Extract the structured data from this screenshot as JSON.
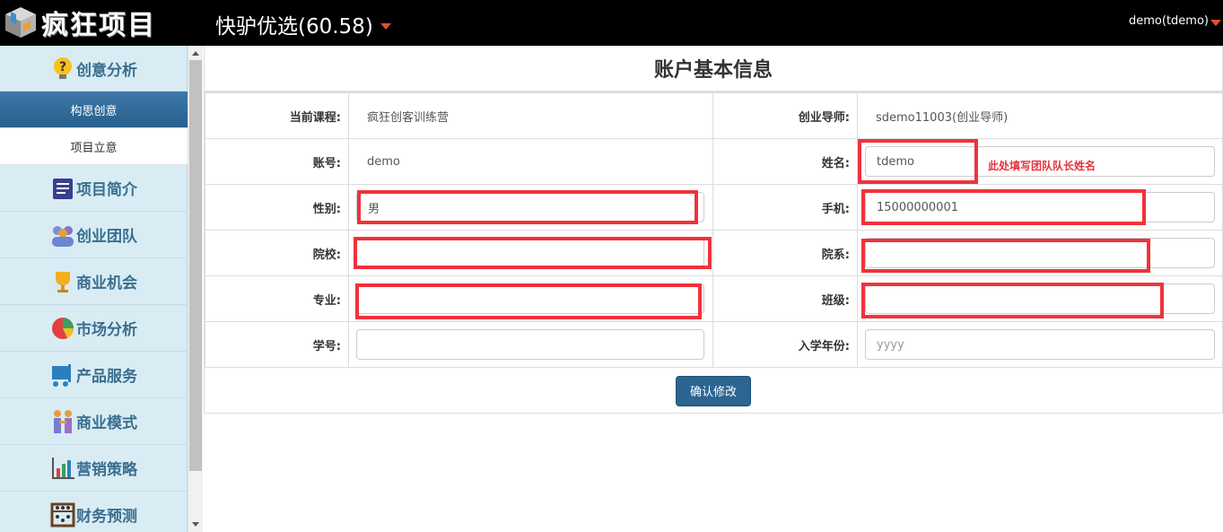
{
  "topbar": {
    "logo_text": "疯狂项目",
    "project_title": "快驴优选(60.58)",
    "user": "demo(tdemo)"
  },
  "sidebar": {
    "categories": [
      {
        "label": "创意分析",
        "icon": "lightbulb-question-icon"
      },
      {
        "label": "项目简介",
        "icon": "document-icon"
      },
      {
        "label": "创业团队",
        "icon": "team-icon"
      },
      {
        "label": "商业机会",
        "icon": "trophy-icon"
      },
      {
        "label": "市场分析",
        "icon": "pie-chart-icon"
      },
      {
        "label": "产品服务",
        "icon": "cart-icon"
      },
      {
        "label": "商业模式",
        "icon": "handshake-icon"
      },
      {
        "label": "营销策略",
        "icon": "bar-chart-icon"
      },
      {
        "label": "财务预测",
        "icon": "abacus-icon"
      }
    ],
    "subitems": [
      {
        "label": "构思创意",
        "active": true
      },
      {
        "label": "项目立意",
        "active": false
      }
    ]
  },
  "panel": {
    "title": "账户基本信息",
    "hint": "此处填写团队队长姓名",
    "submit_label": "确认修改",
    "fields": {
      "course": {
        "label": "当前课程:",
        "value": "疯狂创客训练营"
      },
      "mentor": {
        "label": "创业导师:",
        "value": "sdemo11003(创业导师)"
      },
      "account": {
        "label": "账号:",
        "value": "demo"
      },
      "name": {
        "label": "姓名:",
        "value": "tdemo"
      },
      "gender": {
        "label": "性别:",
        "value": "男"
      },
      "phone": {
        "label": "手机:",
        "value": "15000000001"
      },
      "school": {
        "label": "院校:",
        "value": ""
      },
      "department": {
        "label": "院系:",
        "value": ""
      },
      "major": {
        "label": "专业:",
        "value": ""
      },
      "class": {
        "label": "班级:",
        "value": ""
      },
      "student_id": {
        "label": "学号:",
        "value": ""
      },
      "enroll_year": {
        "label": "入学年份:",
        "value": "",
        "placeholder": "yyyy"
      }
    }
  },
  "colors": {
    "highlight": "#f0323c",
    "sidebar_bg": "#d9ecf4",
    "active_item": "#2b6591"
  }
}
